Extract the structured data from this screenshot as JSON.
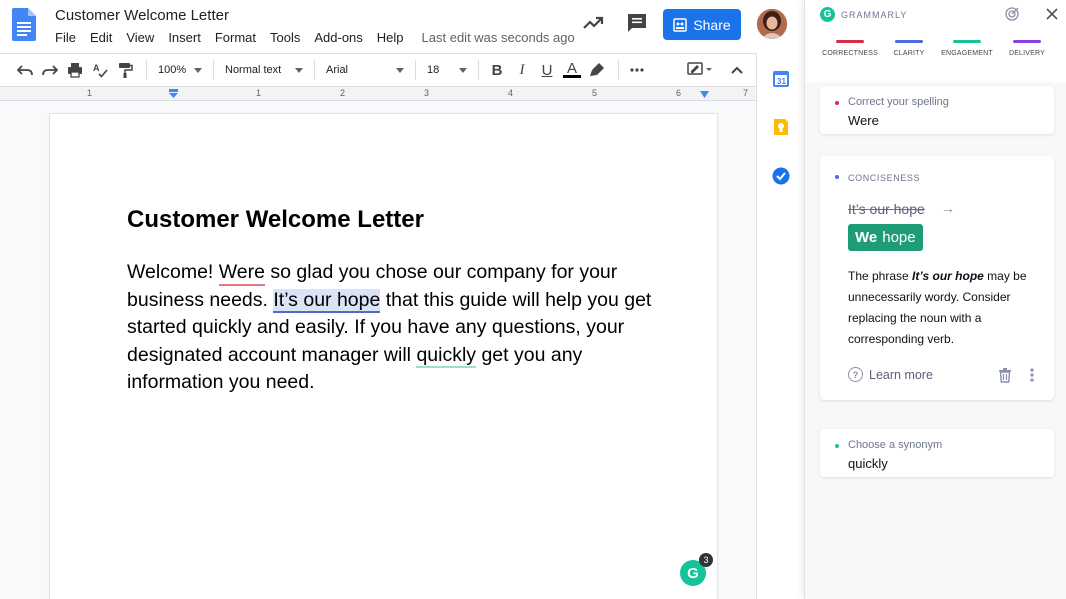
{
  "docs": {
    "title": "Customer Welcome Letter",
    "menu": [
      "File",
      "Edit",
      "View",
      "Insert",
      "Format",
      "Tools",
      "Add-ons",
      "Help"
    ],
    "last_edit": "Last edit was seconds ago",
    "share_label": "Share",
    "toolbar": {
      "zoom": "100%",
      "style": "Normal text",
      "font": "Arial",
      "size": "18",
      "bold": "B",
      "italic": "I",
      "underline": "U",
      "text_color": "A"
    },
    "ruler_numbers": [
      "1",
      "1",
      "2",
      "3",
      "4",
      "5",
      "6",
      "7"
    ],
    "side_icons": [
      "calendar-icon",
      "keep-icon",
      "tasks-icon"
    ]
  },
  "document": {
    "heading": "Customer Welcome Letter",
    "body": {
      "t1": "Welcome! ",
      "flag_spelling": "Were",
      "t2": " so glad you chose our company for your business needs. ",
      "flag_concise": "It’s our hope",
      "t3": " that this guide will help you get started quickly and easily. If you have any questions, your designated account manager will ",
      "flag_synonym": "quickly",
      "t4": " get you any information you need."
    },
    "grammarly_count": "3"
  },
  "grammarly": {
    "brand": "GRAMMARLY",
    "categories": [
      {
        "label": "CORRECTNESS",
        "color": "#d72c4b"
      },
      {
        "label": "CLARITY",
        "color": "#4a6ee0"
      },
      {
        "label": "ENGAGEMENT",
        "color": "#15c39a"
      },
      {
        "label": "DELIVERY",
        "color": "#8b3ee5"
      }
    ],
    "cards": {
      "spelling": {
        "title": "Correct your spelling",
        "word": "Were",
        "color": "#d72c4b"
      },
      "conciseness": {
        "category": "CONCISENESS",
        "original": "It’s our hope",
        "suggest_bold": "We",
        "suggest_rest": "hope",
        "explanation_pre": "The phrase ",
        "explanation_em": "It’s our hope",
        "explanation_post": " may be unnecessarily wordy. Consider replacing the noun with a corresponding verb.",
        "learn_more": "Learn more",
        "color": "#4a6ee0"
      },
      "synonym": {
        "title": "Choose a synonym",
        "word": "quickly",
        "color": "#15c39a"
      }
    }
  }
}
